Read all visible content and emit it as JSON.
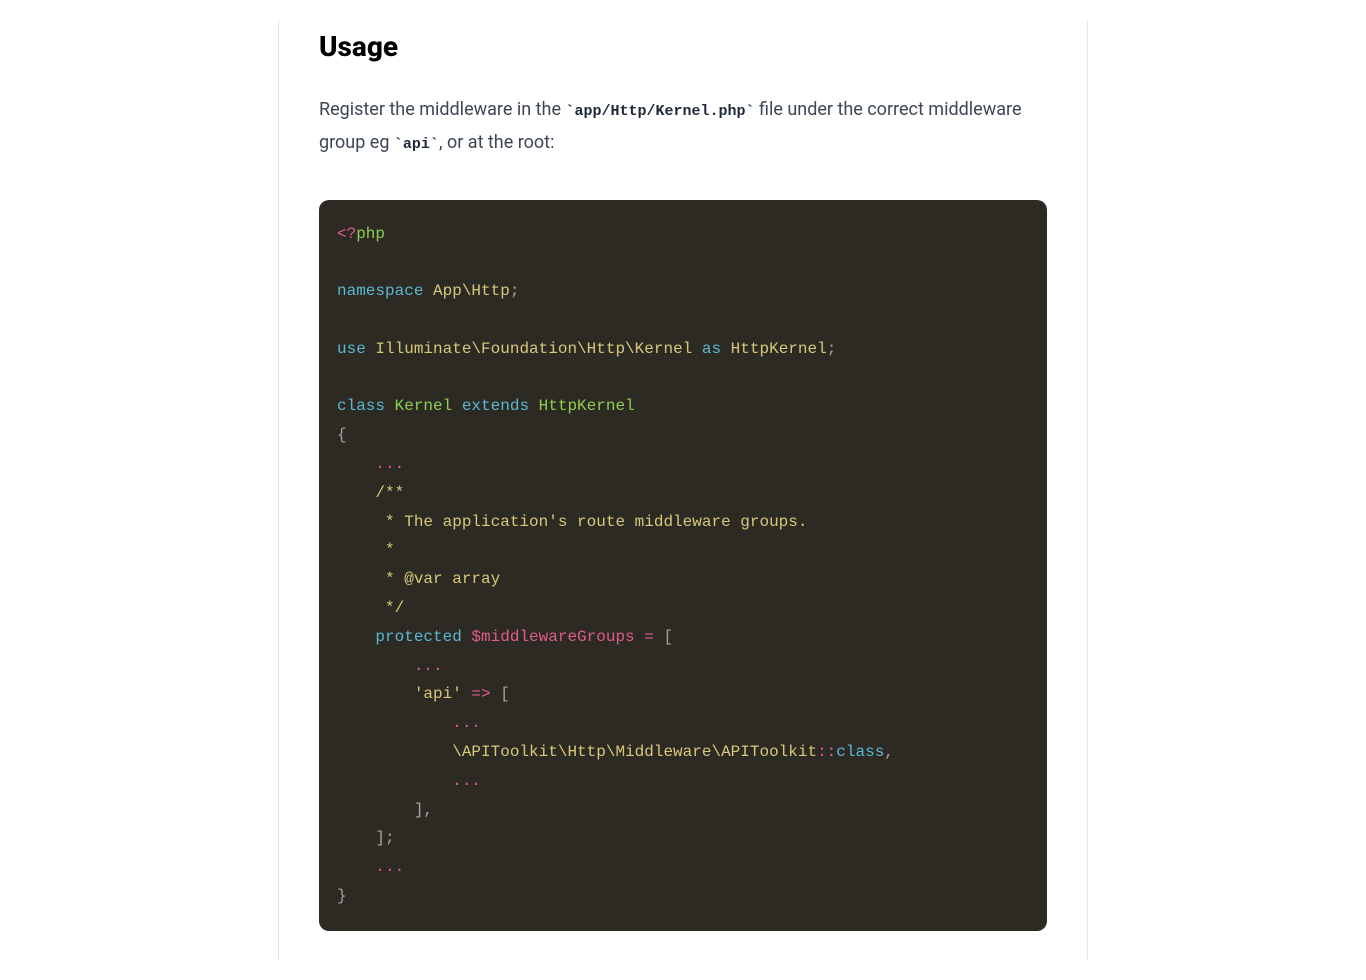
{
  "heading": "Usage",
  "description": {
    "part1": "Register the middleware in the ",
    "code1": "`app/Http/Kernel.php`",
    "part2": " file under the correct middleware group eg ",
    "code2": "`api`",
    "part3": ", or at the root:"
  },
  "code": {
    "line1_open": "<?",
    "line1_php": "php",
    "line2_namespace": "namespace",
    "line2_ns": " App\\Http",
    "line2_semi": ";",
    "line3_use": "use",
    "line3_path": " Illuminate\\Foundation\\Http\\Kernel ",
    "line3_as": "as",
    "line3_alias": " HttpKernel",
    "line3_semi": ";",
    "line4_class": "class",
    "line4_name": " Kernel ",
    "line4_extends": "extends",
    "line4_parent": " HttpKernel",
    "line5_brace": "{",
    "line6_dots": "    ...",
    "line7_comment1": "    /**",
    "line7_comment2": "     * The application's route middleware groups.",
    "line7_comment3": "     *",
    "line7_comment4": "     * @var array",
    "line7_comment5": "     */",
    "line8_protected": "    protected",
    "line8_var": " $middlewareGroups",
    "line8_eq": " = ",
    "line8_bracket": "[",
    "line9_dots": "        ...",
    "line10_key": "        'api'",
    "line10_arrow": " => ",
    "line10_bracket": "[",
    "line11_dots": "            ...",
    "line12_class": "            \\APIToolkit\\Http\\Middleware\\APIToolkit",
    "line12_colon": "::",
    "line12_classword": "class",
    "line12_comma": ",",
    "line13_dots": "            ...",
    "line14_close": "        ],",
    "line15_close": "    ];",
    "line16_dots": "    ...",
    "line17_close": "}"
  }
}
